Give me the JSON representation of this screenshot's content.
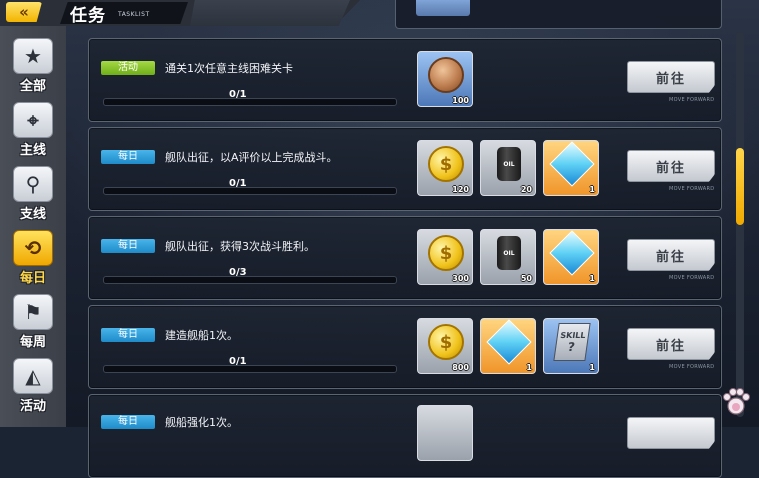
{
  "header": {
    "back_icon": "double-chevron-left-icon",
    "title": "任务",
    "subtitle": "TASKLIST"
  },
  "sidebar": {
    "tabs": [
      {
        "label": "全部",
        "icon": "calendar-star-icon",
        "active": false
      },
      {
        "label": "主线",
        "icon": "map-pin-icon",
        "active": false
      },
      {
        "label": "支线",
        "icon": "branch-pins-icon",
        "active": false
      },
      {
        "label": "每日",
        "icon": "clock-refresh-icon",
        "active": true
      },
      {
        "label": "每周",
        "icon": "flag-icon",
        "active": false
      },
      {
        "label": "活动",
        "icon": "bell-icon",
        "active": false
      }
    ]
  },
  "tasks": [
    {
      "tag": "活动",
      "tag_type": "event",
      "description": "通关1次任意主线困难关卡",
      "progress": "0/1",
      "rewards": [
        {
          "item": "medal-icon",
          "frame": "blue",
          "qty": "100"
        }
      ],
      "button": "前往",
      "button_sub": "MOVE FORWARD"
    },
    {
      "tag": "每日",
      "tag_type": "daily",
      "description": "舰队出征，以A评价以上完成战斗。",
      "progress": "0/1",
      "rewards": [
        {
          "item": "gold-coin-icon",
          "frame": "gray",
          "qty": "120"
        },
        {
          "item": "oil-barrel-icon",
          "frame": "gray",
          "qty": "20",
          "label": "OIL"
        },
        {
          "item": "blue-cube-icon",
          "frame": "gold",
          "qty": "1"
        }
      ],
      "button": "前往",
      "button_sub": "MOVE FORWARD"
    },
    {
      "tag": "每日",
      "tag_type": "daily",
      "description": "舰队出征，获得3次战斗胜利。",
      "progress": "0/3",
      "rewards": [
        {
          "item": "gold-coin-icon",
          "frame": "gray",
          "qty": "300"
        },
        {
          "item": "oil-barrel-icon",
          "frame": "gray",
          "qty": "50",
          "label": "OIL"
        },
        {
          "item": "blue-cube-icon",
          "frame": "gold",
          "qty": "1"
        }
      ],
      "button": "前往",
      "button_sub": "MOVE FORWARD"
    },
    {
      "tag": "每日",
      "tag_type": "daily",
      "description": "建造舰船1次。",
      "progress": "0/1",
      "rewards": [
        {
          "item": "gold-coin-icon",
          "frame": "gray",
          "qty": "800"
        },
        {
          "item": "blue-cube-icon",
          "frame": "gold",
          "qty": "1"
        },
        {
          "item": "skill-book-icon",
          "frame": "blue",
          "qty": "1",
          "label": "SKILL"
        }
      ],
      "button": "前往",
      "button_sub": "MOVE FORWARD"
    },
    {
      "tag": "每日",
      "tag_type": "daily",
      "description": "舰船强化1次。",
      "partial": true
    }
  ],
  "scrollbar": {
    "position": 0.25,
    "visible_fraction": 0.5
  },
  "colors": {
    "accent": "#f0b400",
    "daily_tag": "#1e8bc9",
    "event_tag": "#6fae18"
  },
  "corner_icon": "paw-icon"
}
